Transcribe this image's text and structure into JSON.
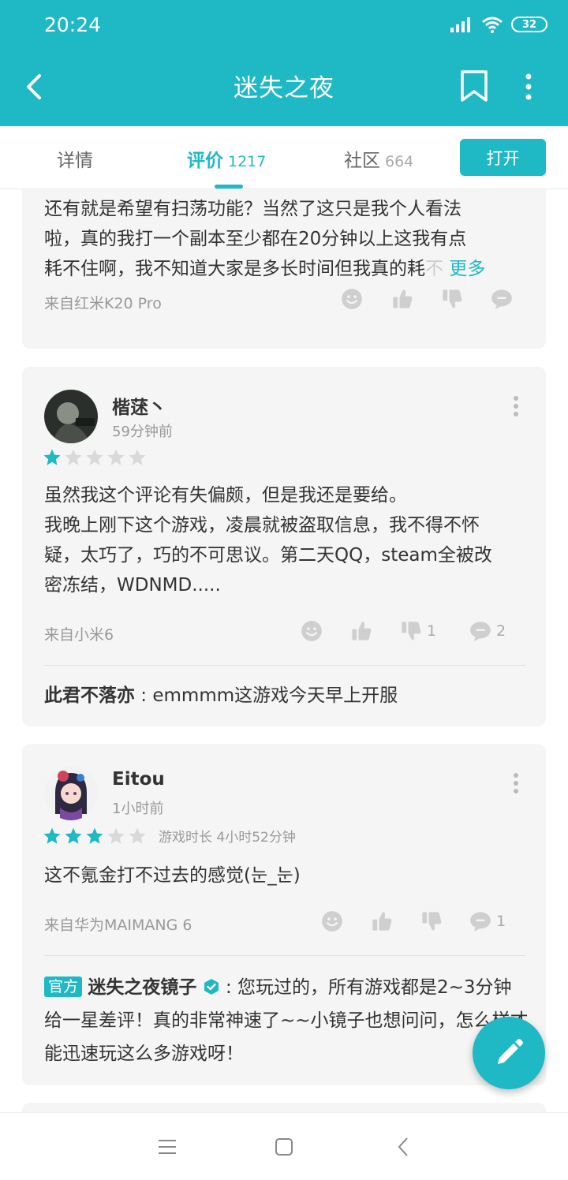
{
  "status_bar": {
    "time": "20:24",
    "battery": "32"
  },
  "app_bar": {
    "title": "迷失之夜"
  },
  "tabs": [
    {
      "label": "详情",
      "count": ""
    },
    {
      "label": "评价",
      "count": "1217"
    },
    {
      "label": "社区",
      "count": "664"
    }
  ],
  "open_button": "打开",
  "reviews": [
    {
      "text_lines": [
        "还有就是希望有扫荡功能？当然了这只是我个人看法",
        "啦，真的我打一个副本至少都在20分钟以上这我有点",
        "耗不住啊，我不知道大家是多长时间但我真的耗"
      ],
      "faded_tail": "不",
      "more_label": "更多",
      "device": "来自红米K20 Pro",
      "dislikes": "",
      "comments": ""
    },
    {
      "user": "楷蒁丶",
      "time": "59分钟前",
      "rating": 1,
      "text_lines": [
        "虽然我这个评论有失偏颇，但是我还是要给。",
        "我晚上刚下这个游戏，凌晨就被盗取信息，我不得不怀",
        "疑，太巧了，巧的不可思议。第二天QQ，steam全被改",
        "密冻结，WDNMD....."
      ],
      "device": "来自小米6",
      "dislikes": "1",
      "comments": "2",
      "reply": {
        "author": "此君不落亦",
        "text": " : emmmm这游戏今天早上开服"
      }
    },
    {
      "user": "Eitou",
      "time": "1小时前",
      "rating": 3,
      "playtime": "游戏时长 4小时52分钟",
      "text_lines": [
        "这不氪金打不过去的感觉(눈_눈)"
      ],
      "device": "来自华为MAIMANG 6",
      "dislikes": "",
      "comments": "1",
      "reply": {
        "badge": "官方",
        "author": "迷失之夜镜子",
        "text": " : 您玩过的，所有游戏都是2~3分钟给一星差评！真的非常神速了~~小镜子也想问问，怎么样才能迅速玩这么多游戏呀！"
      }
    }
  ],
  "icons": [
    "back-icon",
    "bookmark-icon",
    "more-vert-icon",
    "emoji-icon",
    "thumb-up-icon",
    "thumb-down-icon",
    "comment-icon",
    "edit-icon"
  ],
  "colors": {
    "accent": "#1fb8c5",
    "card": "#f5f5f5",
    "star_off": "#d9d9d9"
  }
}
